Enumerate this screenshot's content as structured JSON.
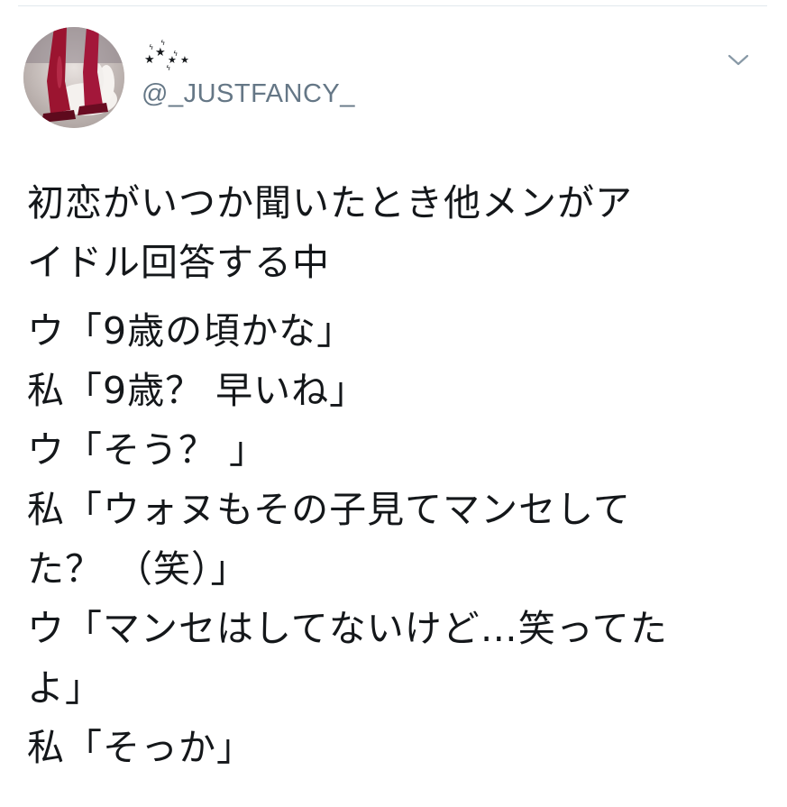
{
  "tweet": {
    "display_name": "⋆*⋆⋆",
    "handle": "@_JUSTFANCY_",
    "paragraph1": [
      "初恋がいつか聞いたとき他メンがア",
      "イドル回答する中"
    ],
    "paragraph2": [
      "ウ「9歳の頃かな」",
      "私「9歳？ 早いね」",
      "ウ「そう？ 」",
      "私「ウォヌもその子見てマンセして",
      "た？ （笑）」",
      "ウ「マンセはしてないけど…笑ってた",
      "よ」",
      "私「そっか」"
    ]
  },
  "icons": {
    "menu": "chevron-down-icon"
  },
  "colors": {
    "text": "#14171a",
    "secondary": "#657786",
    "divider": "#e1e8ed"
  }
}
